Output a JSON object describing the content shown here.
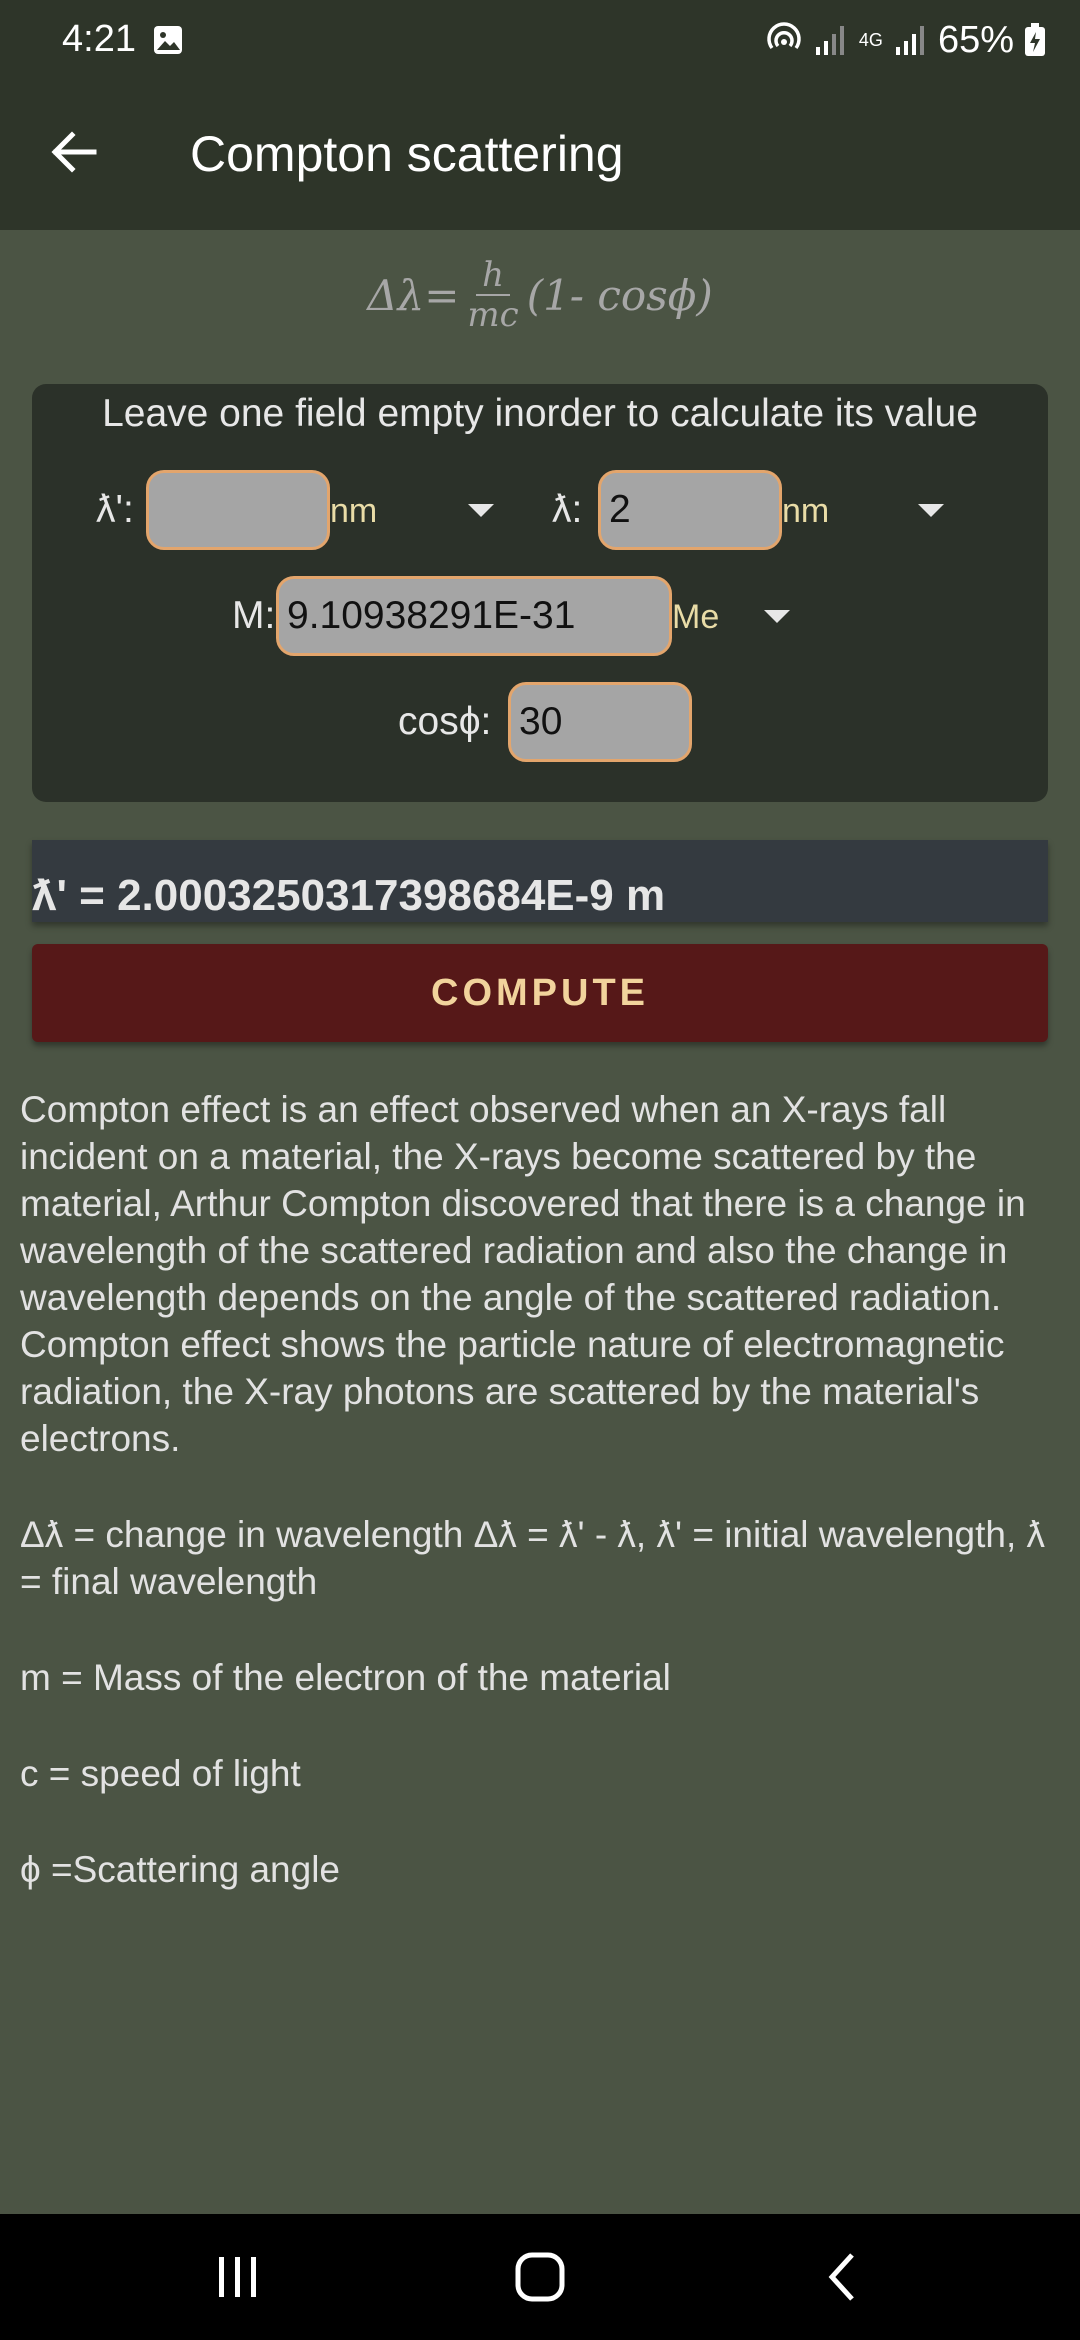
{
  "status_bar": {
    "time": "4:21",
    "network": "4G",
    "battery": "65%"
  },
  "app_bar": {
    "title": "Compton scattering"
  },
  "formula": {
    "lhs": "Δλ=",
    "numerator": "h",
    "denominator": "mc",
    "rhs": "(1- cosϕ)"
  },
  "form": {
    "instruction": "Leave one field empty inorder to calculate its value",
    "lambda_prime": {
      "label": "ƛ':",
      "value": "",
      "unit": "nm"
    },
    "lambda": {
      "label": "ƛ:",
      "value": "2",
      "unit": "nm"
    },
    "mass": {
      "label": "M:",
      "value": "9.10938291E-31",
      "unit": "Me"
    },
    "cos_phi": {
      "label": "cosϕ:",
      "value": "30"
    }
  },
  "result": {
    "text": "ƛ' = 2.0003250317398684E-9 m"
  },
  "compute_label": "COMPUTE",
  "description": {
    "paragraph1": "Compton effect is an effect observed when an X-rays fall incident on a material, the X-rays become scattered by the material, Arthur Compton discovered that there is a change in wavelength of the scattered radiation and also the change in wavelength depends on the angle of the scattered radiation. Compton effect shows the particle nature of electromagnetic radiation, the X-ray photons are scattered by the material's electrons.",
    "paragraph2": "Δƛ = change in wavelength Δƛ = ƛ' - ƛ, ƛ' = initial wavelength, ƛ = final wavelength",
    "paragraph3": "m = Mass of the electron of the material",
    "paragraph4": "c = speed of light",
    "paragraph5": "ϕ =Scattering angle"
  },
  "colors": {
    "app_bar": "#2e3529",
    "background": "#4b5444",
    "card": "#2b3129",
    "input_border": "#e3a56c",
    "compute_button": "#561818",
    "compute_text": "#f1d39c",
    "unit_text": "#e9dca7"
  },
  "icons": {
    "back": "arrow-left-icon",
    "status_image": "image-icon",
    "hotspot": "hotspot-icon",
    "signal": "signal-icon",
    "battery": "battery-charging-icon",
    "nav_recents": "recents-icon",
    "nav_home": "home-icon",
    "nav_back": "chevron-left-icon"
  }
}
